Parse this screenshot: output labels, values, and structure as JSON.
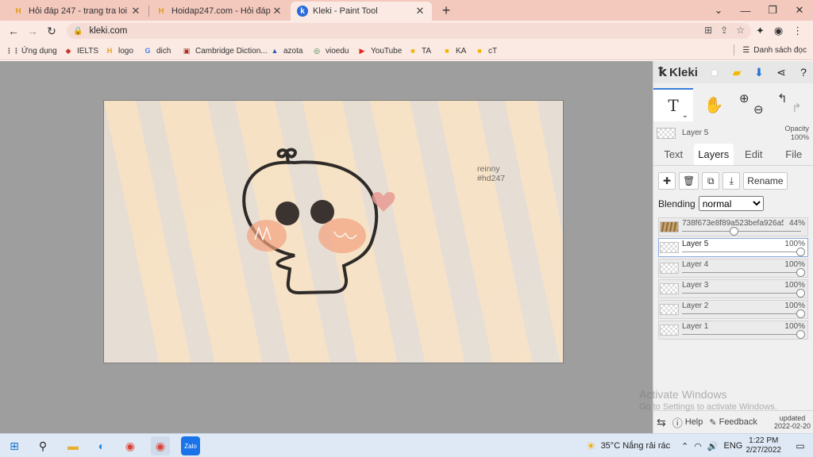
{
  "browser": {
    "tabs": [
      {
        "title": "Hỏi đáp 247 - trang tra loi",
        "active": false
      },
      {
        "title": "Hoidap247.com - Hỏi đáp online",
        "active": false
      },
      {
        "title": "Kleki - Paint Tool",
        "active": true
      }
    ],
    "url": "kleki.com",
    "bookmarks": [
      {
        "label": "Ứng dụng",
        "icon": "apps-grid-icon"
      },
      {
        "label": "IELTS",
        "icon": "ielts-icon"
      },
      {
        "label": "logo",
        "icon": "hoidap-icon"
      },
      {
        "label": "dich",
        "icon": "google-icon"
      },
      {
        "label": "Cambridge Diction...",
        "icon": "cambridge-icon"
      },
      {
        "label": "azota",
        "icon": "azota-icon"
      },
      {
        "label": "vioedu",
        "icon": "vioedu-icon"
      },
      {
        "label": "YouTube",
        "icon": "youtube-icon"
      },
      {
        "label": "TA",
        "icon": "classroom-icon"
      },
      {
        "label": "KA",
        "icon": "classroom-icon"
      },
      {
        "label": "cT",
        "icon": "classroom-icon"
      }
    ],
    "reading_list": "Danh sách đọc"
  },
  "canvas": {
    "signature_line1": "reinny",
    "signature_line2": "#hd247"
  },
  "kleki": {
    "logo": "Kleki",
    "current_layer_name": "Layer 5",
    "opacity_label": "Opacity",
    "opacity_value": "100%",
    "tabs": [
      "Text",
      "Layers",
      "Edit",
      "File"
    ],
    "active_tab": "Layers",
    "rename_label": "Rename",
    "blending_label": "Blending",
    "blending_value": "normal",
    "layers": [
      {
        "name": "738f673e8f89a523befa926a5",
        "opacity": "44%",
        "value": 0.44,
        "selected": false
      },
      {
        "name": "Layer 5",
        "opacity": "100%",
        "value": 1.0,
        "selected": true
      },
      {
        "name": "Layer 4",
        "opacity": "100%",
        "value": 1.0,
        "selected": false
      },
      {
        "name": "Layer 3",
        "opacity": "100%",
        "value": 1.0,
        "selected": false
      },
      {
        "name": "Layer 2",
        "opacity": "100%",
        "value": 1.0,
        "selected": false
      },
      {
        "name": "Layer 1",
        "opacity": "100%",
        "value": 1.0,
        "selected": false
      }
    ],
    "help": "Help",
    "feedback": "Feedback",
    "updated_line1": "updated",
    "updated_line2": "2022-02-20"
  },
  "watermark": {
    "line1": "Activate Windows",
    "line2": "Go to Settings to activate Windows."
  },
  "taskbar": {
    "weather": "35°C  Nắng rải rác",
    "language": "ENG",
    "time": "1:22 PM",
    "date": "2/27/2022"
  }
}
